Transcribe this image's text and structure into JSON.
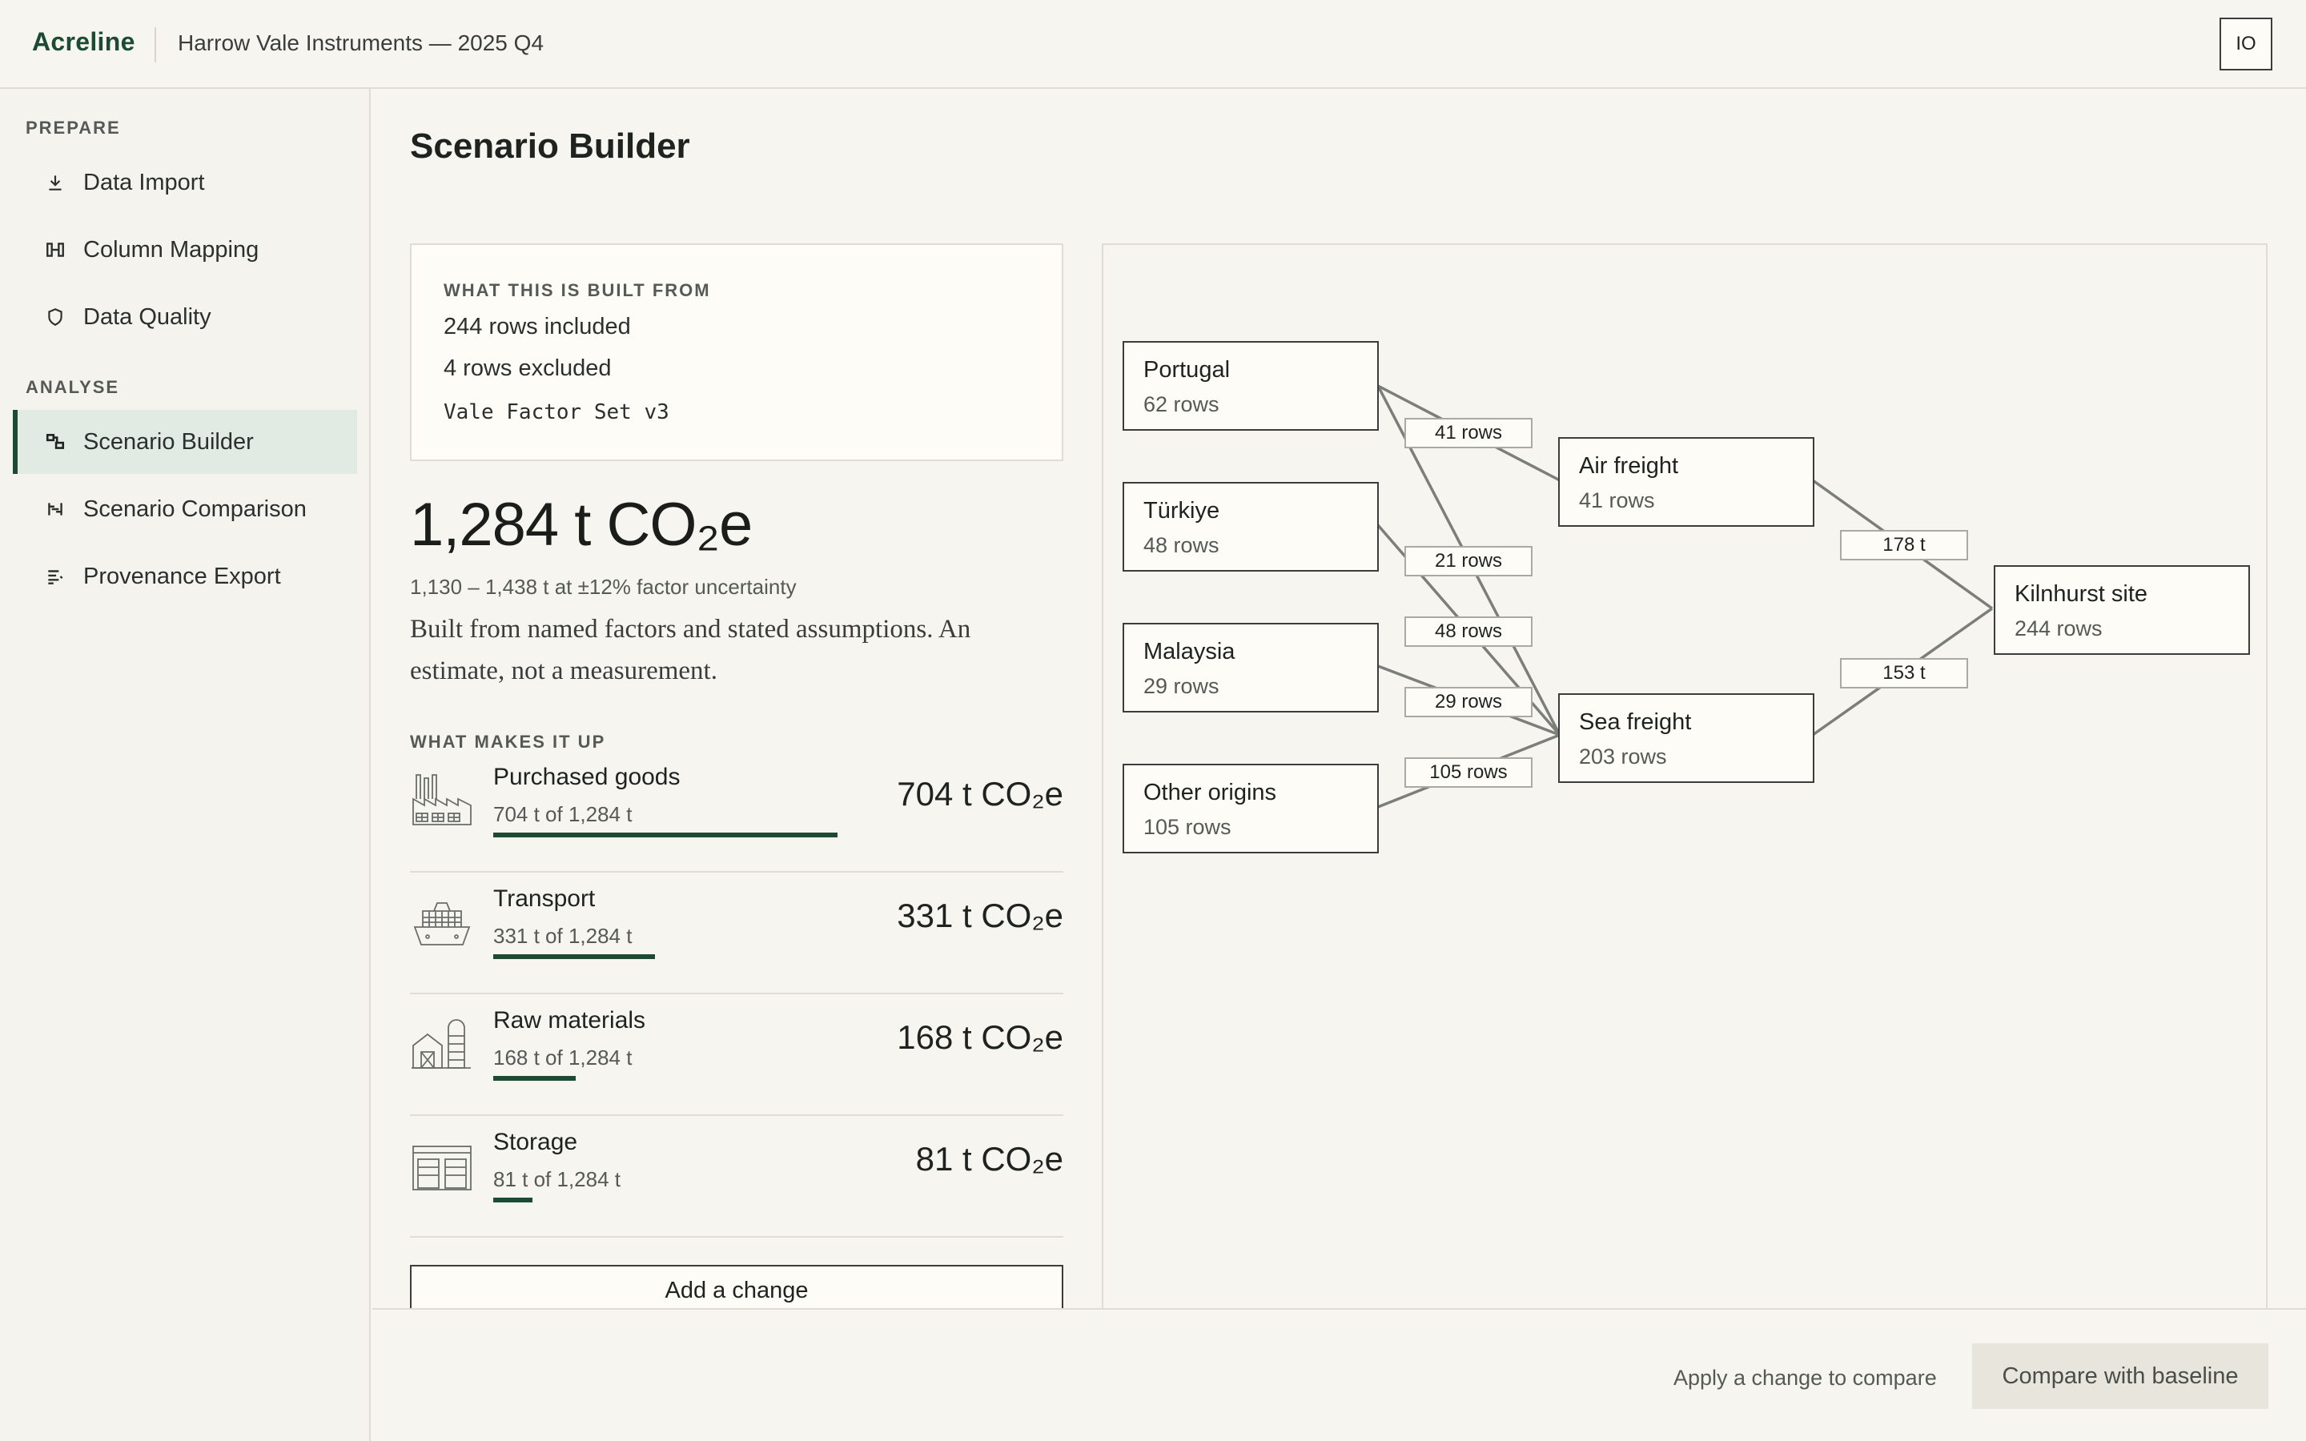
{
  "header": {
    "brand": "Acreline",
    "project": "Harrow Vale Instruments — 2025 Q4",
    "avatar_initials": "IO"
  },
  "sidebar": {
    "sections": [
      {
        "label": "PREPARE",
        "items": [
          {
            "label": "Data Import",
            "icon": "download-icon"
          },
          {
            "label": "Column Mapping",
            "icon": "columns-icon"
          },
          {
            "label": "Data Quality",
            "icon": "shield-icon"
          }
        ]
      },
      {
        "label": "ANALYSE",
        "items": [
          {
            "label": "Scenario Builder",
            "icon": "scenario-icon",
            "active": true
          },
          {
            "label": "Scenario Comparison",
            "icon": "compare-icon"
          },
          {
            "label": "Provenance Export",
            "icon": "list-export-icon"
          }
        ]
      }
    ]
  },
  "main": {
    "title": "Scenario Builder",
    "built_from": {
      "eyebrow": "WHAT THIS IS BUILT FROM",
      "included": "244 rows included",
      "excluded": "4 rows excluded",
      "factor_set": "Vale Factor Set v3"
    },
    "total": "1,284 t CO₂e",
    "uncertainty": "1,130 – 1,438 t at ±12% factor uncertainty",
    "caveat": "Built from named factors and stated assumptions. An estimate, not a measurement.",
    "makes_up_label": "WHAT MAKES IT UP",
    "categories": [
      {
        "name": "Purchased goods",
        "sub": "704 t of 1,284 t",
        "value": "704 t CO₂e",
        "share": 0.548,
        "icon": "factory-icon"
      },
      {
        "name": "Transport",
        "sub": "331 t of 1,284 t",
        "value": "331 t CO₂e",
        "share": 0.258,
        "icon": "ship-icon"
      },
      {
        "name": "Raw materials",
        "sub": "168 t of 1,284 t",
        "value": "168 t CO₂e",
        "share": 0.131,
        "icon": "farm-icon"
      },
      {
        "name": "Storage",
        "sub": "81 t of 1,284 t",
        "value": "81 t CO₂e",
        "share": 0.063,
        "icon": "warehouse-icon"
      }
    ],
    "add_change": "Add a change"
  },
  "flow": {
    "origins": [
      {
        "name": "Portugal",
        "rows": "62 rows"
      },
      {
        "name": "Türkiye",
        "rows": "48 rows"
      },
      {
        "name": "Malaysia",
        "rows": "29 rows"
      },
      {
        "name": "Other origins",
        "rows": "105 rows"
      }
    ],
    "modes": [
      {
        "name": "Air freight",
        "rows": "41 rows"
      },
      {
        "name": "Sea freight",
        "rows": "203 rows"
      }
    ],
    "site": {
      "name": "Kilnhurst site",
      "rows": "244 rows"
    },
    "origin_edge_labels": [
      "41 rows",
      "21 rows",
      "48 rows",
      "29 rows",
      "105 rows"
    ],
    "mode_edge_labels": [
      "178 t",
      "153 t"
    ]
  },
  "footer": {
    "hint": "Apply a change to compare",
    "compare_button": "Compare with baseline"
  }
}
